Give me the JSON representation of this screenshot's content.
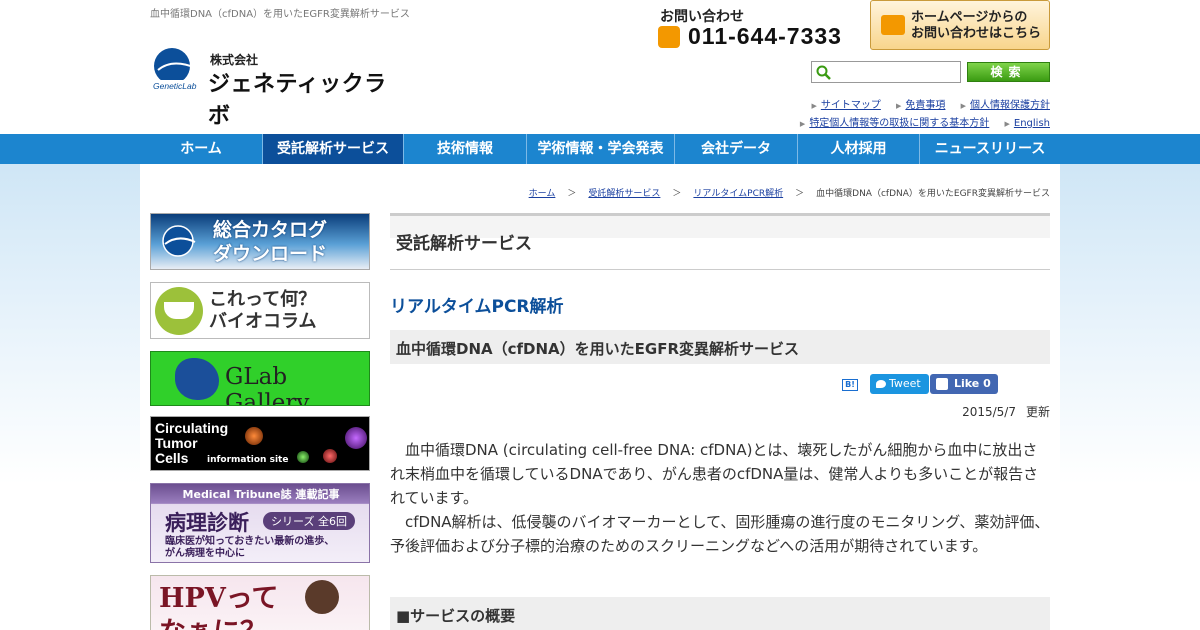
{
  "header": {
    "tagline": "血中循環DNA（cfDNA）を用いたEGFR変異解析サービス",
    "logo_company": "株式会社",
    "logo_name": "ジェネティックラボ",
    "logo_mark_text": "GeneticLab",
    "contact_label": "お問い合わせ",
    "phone_number": "011-644-7333",
    "contact_button": "ホームページからの\nお問い合わせはこちら",
    "search_placeholder": "",
    "search_button": "検索",
    "links_row1": [
      "サイトマップ",
      "免責事項",
      "個人情報保護方針"
    ],
    "links_row2": [
      "特定個人情報等の取扱に関する基本方針",
      "English"
    ]
  },
  "nav": {
    "items": [
      "ホーム",
      "受託解析サービス",
      "技術情報",
      "学術情報・学会発表",
      "会社データ",
      "人材採用",
      "ニュースリリース"
    ],
    "active_index": 1
  },
  "breadcrumb": {
    "links": [
      "ホーム",
      "受託解析サービス",
      "リアルタイムPCR解析"
    ],
    "current": "血中循環DNA（cfDNA）を用いたEGFR変異解析サービス",
    "separator": "＞"
  },
  "sidebar": {
    "banners": [
      {
        "text": "総合カタログ\nダウンロード"
      },
      {
        "text": "これって何？\nバイオコラム"
      },
      {
        "text": "GLab Gallery"
      },
      {
        "text": "Circulating\nTumor\nCells",
        "sub": "information site"
      },
      {
        "head": "Medical Tribune誌 連載記事",
        "title": "病理診断",
        "badge": "シリーズ 全6回",
        "sub": "臨床医が知っておきたい最新の進歩、\nがん病理を中心に"
      },
      {
        "text": "HPVって\nなぁに？"
      }
    ]
  },
  "main": {
    "section_title": "受託解析サービス",
    "sub_title": "リアルタイムPCR解析",
    "service_title": "血中循環DNA（cfDNA）を用いたEGFR変異解析サービス",
    "hatena_label": "B!",
    "tweet_label": "Tweet",
    "like_label": "Like 0",
    "updated_date": "2015/5/7",
    "updated_label": "更新",
    "paragraphs": [
      "血中循環DNA (circulating cell-free DNA: cfDNA)とは、壊死したがん細胞から血中に放出され末梢血中を循環しているDNAであり、がん患者のcfDNA量は、健常人よりも多いことが報告されています。",
      "cfDNA解析は、低侵襲のバイオマーカーとして、固形腫瘍の進行度のモニタリング、薬効評価、予後評価および分子標的治療のためのスクリーニングなどへの活用が期待されています。"
    ],
    "overview_title": "■サービスの概要"
  }
}
